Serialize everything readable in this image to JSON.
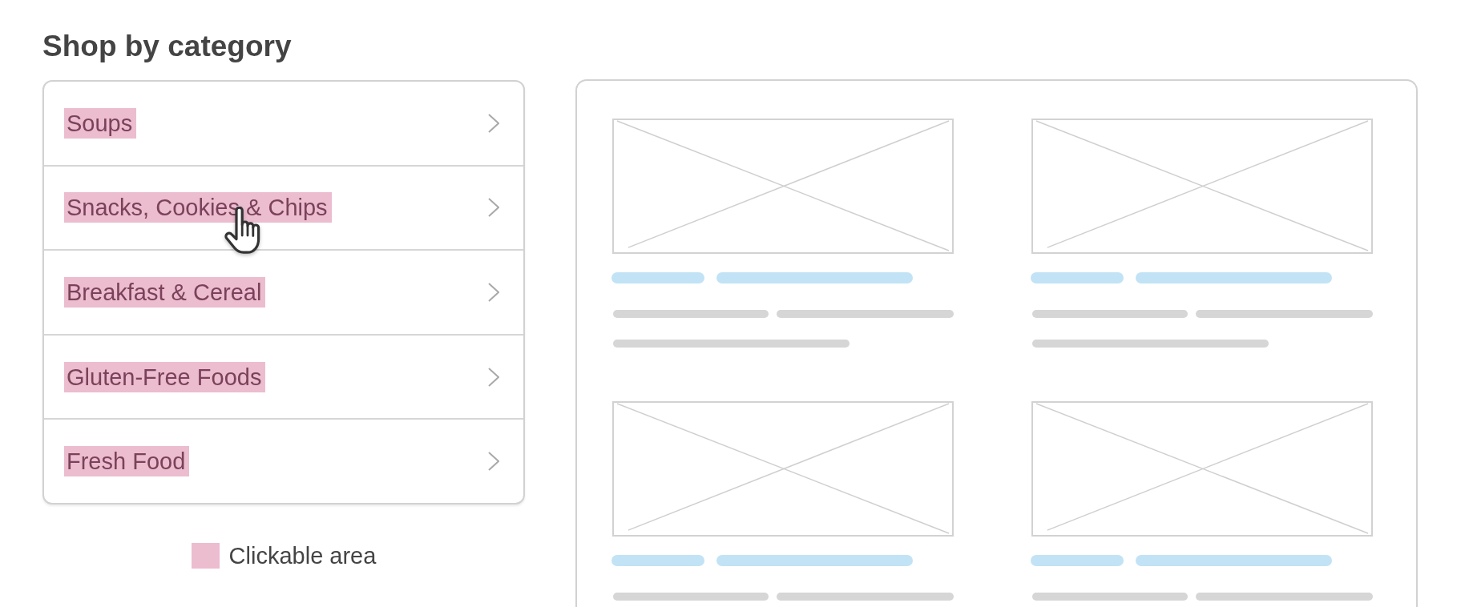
{
  "heading": "Shop by category",
  "categories": [
    {
      "label": "Soups",
      "hovered": false
    },
    {
      "label": "Snacks, Cookies & Chips",
      "hovered": true
    },
    {
      "label": "Breakfast & Cereal",
      "hovered": false
    },
    {
      "label": "Gluten-Free Foods",
      "hovered": false
    },
    {
      "label": "Fresh Food",
      "hovered": false
    }
  ],
  "legend": {
    "label": "Clickable area"
  },
  "product_cards": [
    {
      "parts": [
        {
          "kind": "image"
        },
        {
          "kind": "accent_bars"
        },
        {
          "kind": "text_lines"
        },
        {
          "kind": "text_line"
        }
      ]
    },
    {
      "parts": [
        {
          "kind": "image"
        },
        {
          "kind": "accent_bars"
        },
        {
          "kind": "text_lines"
        },
        {
          "kind": "text_line"
        }
      ]
    },
    {
      "parts": [
        {
          "kind": "image"
        },
        {
          "kind": "accent_bars"
        },
        {
          "kind": "text_lines"
        }
      ]
    },
    {
      "parts": [
        {
          "kind": "image"
        },
        {
          "kind": "accent_bars"
        },
        {
          "kind": "text_lines"
        }
      ]
    }
  ]
}
